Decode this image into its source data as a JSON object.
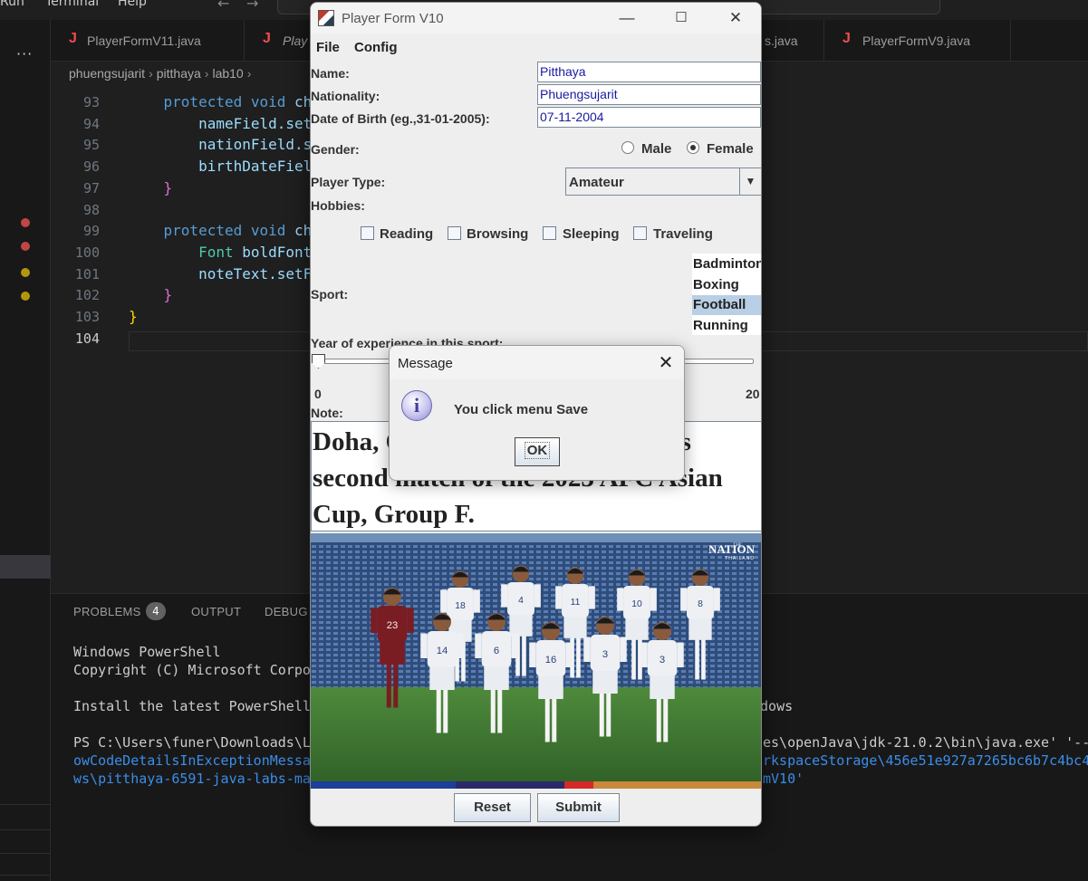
{
  "vscode": {
    "menu": [
      "Run",
      "Terminal",
      "Help"
    ],
    "tabs": [
      "PlayerFormV11.java",
      "Play",
      "s.java",
      "PlayerFormV9.java"
    ],
    "tab_icon_letter": "J",
    "breadcrumb": [
      "phuengsujarit",
      "pitthaya",
      "lab10"
    ],
    "more_icon": "···",
    "code_lines": [
      {
        "num": "93",
        "segments": [
          {
            "t": "    "
          },
          {
            "t": "protected",
            "c": "kw"
          },
          {
            "t": " "
          },
          {
            "t": "void",
            "c": "kw"
          },
          {
            "t": " ch"
          }
        ]
      },
      {
        "num": "94",
        "segments": [
          {
            "t": "        nameField.set"
          }
        ]
      },
      {
        "num": "95",
        "segments": [
          {
            "t": "        nationField.s"
          }
        ]
      },
      {
        "num": "96",
        "segments": [
          {
            "t": "        birthDateFiel"
          }
        ]
      },
      {
        "num": "97",
        "segments": [
          {
            "t": "    "
          },
          {
            "t": "}",
            "c": "br"
          }
        ]
      },
      {
        "num": "98",
        "segments": []
      },
      {
        "num": "99",
        "segments": [
          {
            "t": "    "
          },
          {
            "t": "protected",
            "c": "kw"
          },
          {
            "t": " "
          },
          {
            "t": "void",
            "c": "kw"
          },
          {
            "t": " ch"
          }
        ]
      },
      {
        "num": "100",
        "segments": [
          {
            "t": "        "
          },
          {
            "t": "Font",
            "c": "ty"
          },
          {
            "t": " boldFont"
          }
        ]
      },
      {
        "num": "101",
        "segments": [
          {
            "t": "        noteText.setF"
          }
        ]
      },
      {
        "num": "102",
        "segments": [
          {
            "t": "    "
          },
          {
            "t": "}",
            "c": "br"
          }
        ]
      },
      {
        "num": "103",
        "segments": [
          {
            "t": "}",
            "c": "br2"
          }
        ]
      },
      {
        "num": "104",
        "segments": []
      }
    ],
    "panel_tabs": [
      "PROBLEMS",
      "OUTPUT",
      "DEBUG C"
    ],
    "problems_count": "4",
    "terminal": [
      {
        "text": "Windows PowerShell",
        "blue": false
      },
      {
        "text": "Copyright (C) Microsoft Corpo",
        "blue": false
      },
      {
        "text": "",
        "blue": false
      },
      {
        "text": "Install the latest PowerShell",
        "blue": false
      },
      {
        "text": "",
        "blue": false
      },
      {
        "text": "PS C:\\Users\\funer\\Downloads\\L",
        "blue": false
      },
      {
        "text": "owCodeDetailsInExceptionMessa",
        "blue": true
      },
      {
        "text": "ws\\pitthaya-6591-java-labs-ma",
        "blue": true
      }
    ],
    "terminal_right": [
      {
        "text": "ndows",
        "blue": false
      },
      {
        "text": "es\\openJava\\jdk-21.0.2\\bin\\java.exe' '--e",
        "blue": false
      },
      {
        "text": "rkspaceStorage\\456e51e927a7265bc6b7c4bc45",
        "blue": true
      },
      {
        "text": "mV10'",
        "blue": true
      }
    ],
    "colors": {
      "breakpoint_red": "#c24545",
      "breakpoint_yellow": "#b3960f"
    }
  },
  "form": {
    "title": "Player Form V10",
    "window_controls": {
      "minimize": "—",
      "maximize": "☐",
      "close": "✕"
    },
    "menu": [
      "File",
      "Config"
    ],
    "name_label": "Name:",
    "name_value": "Pitthaya",
    "nationality_label": "Nationality:",
    "nationality_value": "Phuengsujarit",
    "dob_label": "Date of Birth (eg.,31-01-2005):",
    "dob_value": "07-11-2004",
    "gender_label": "Gender:",
    "gender_options": [
      "Male",
      "Female"
    ],
    "gender_selected": "Female",
    "player_type_label": "Player Type:",
    "player_type_value": "Amateur",
    "dropdown_icon": "chevron-down-icon",
    "hobbies_label": "Hobbies:",
    "hobbies": [
      "Reading",
      "Browsing",
      "Sleeping",
      "Traveling"
    ],
    "sport_label": "Sport:",
    "sports": [
      "Badminton",
      "Boxing",
      "Football",
      "Running"
    ],
    "sport_selected": "Football",
    "experience_label": "Year of experience in this sport:",
    "experience_min": "0",
    "experience_max": "20",
    "experience_value": 0,
    "note_label": "Note:",
    "note_text": "Doha, Qatar — Thailand plays its second match of the 2023 AFC Asian Cup, Group F.",
    "photo_watermark": "NATION",
    "photo_watermark_small": "THE",
    "photo_watermark_sub": "THAILAND",
    "jersey_numbers": [
      "18",
      "4",
      "11",
      "10",
      "8",
      "23",
      "14",
      "6",
      "16",
      "3"
    ],
    "reset_label": "Reset",
    "submit_label": "Submit"
  },
  "dialog": {
    "title": "Message",
    "close": "✕",
    "icon": "info-icon",
    "icon_glyph": "i",
    "message": "You click menu Save",
    "ok_label": "OK"
  }
}
